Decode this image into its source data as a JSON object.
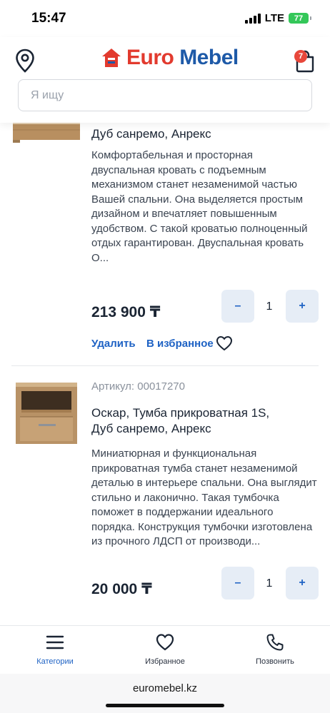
{
  "status_bar": {
    "time": "15:47",
    "network": "LTE",
    "battery": "77"
  },
  "header": {
    "logo": {
      "euro": "Euro",
      "mebel": "Mebel"
    },
    "cart_count": "7",
    "search_placeholder": "Я ищу"
  },
  "products": [
    {
      "title": "Дуб санремо, Анрекс",
      "description": "Комфортабельная и просторная двуспальная кровать с подъемным механизмом станет незаменимой частью Вашей спальни. Она выделяется простым дизайном и впечатляет повышенным удобством. С такой кроватью полноценный отдых гарантирован. Двуспальная кровать О...",
      "price": "213 900 ₸",
      "quantity": "1",
      "minus": "–",
      "plus": "+",
      "delete_label": "Удалить",
      "favorite_label": "В избранное"
    },
    {
      "article": "Артикул: 00017270",
      "title": "Оскар, Тумба прикроватная 1S, Дуб санремо, Анрекс",
      "description": "Миниатюрная и функциональная прикроватная тумба станет незаменимой деталью в интерьере спальни. Она выглядит стильно и лаконично. Такая тумбочка поможет в поддержании идеального порядка. Конструкция тумбочки изготовлена из прочного ЛДСП от производи...",
      "price": "20 000 ₸",
      "quantity": "1",
      "minus": "–",
      "plus": "+"
    }
  ],
  "bottom_nav": [
    {
      "label": "Категории",
      "icon": "menu-icon",
      "active": true
    },
    {
      "label": "Избранное",
      "icon": "heart-icon",
      "active": false
    },
    {
      "label": "Позвонить",
      "icon": "phone-icon",
      "active": false
    }
  ],
  "browser": {
    "url": "euromebel.kz"
  },
  "colors": {
    "accent": "#1e62c4",
    "brand_red": "#e23a2e",
    "brand_blue": "#1e5aa8",
    "qty_button_bg": "#e6edf6"
  }
}
